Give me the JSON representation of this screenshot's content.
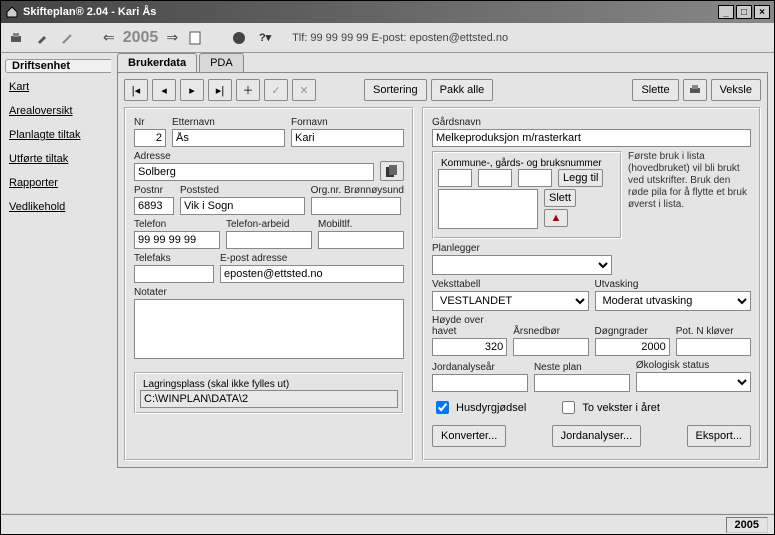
{
  "window": {
    "title": "Skifteplan® 2.04 - Kari Ås"
  },
  "toolbar": {
    "year": "2005",
    "contact": "Tlf: 99 99 99 99  E-post: eposten@ettsted.no"
  },
  "sidebar": {
    "tab": "Driftsenhet",
    "items": [
      "Kart",
      "Arealoversikt",
      "Planlagte tiltak",
      "Utførte tiltak",
      "Rapporter",
      "Vedlikehold"
    ]
  },
  "tabs": {
    "brukerdata": "Brukerdata",
    "pda": "PDA"
  },
  "buttons": {
    "sortering": "Sortering",
    "pakk_alle": "Pakk alle",
    "slette": "Slette",
    "veksle": "Veksle",
    "legg_til": "Legg til",
    "slett": "Slett",
    "konverter": "Konverter...",
    "jordanalyser": "Jordanalyser...",
    "eksport": "Eksport..."
  },
  "labels": {
    "nr": "Nr",
    "etternavn": "Etternavn",
    "fornavn": "Fornavn",
    "adresse": "Adresse",
    "postnr": "Postnr",
    "poststed": "Poststed",
    "orgnr": "Org.nr. Brønnøysund",
    "telefon": "Telefon",
    "telefon_arbeid": "Telefon-arbeid",
    "mobiltlf": "Mobiltlf.",
    "telefaks": "Telefaks",
    "epost": "E-post adresse",
    "notater": "Notater",
    "lagring": "Lagringsplass (skal ikke fylles ut)",
    "gardsnavn": "Gårdsnavn",
    "kommune": "Kommune-, gårds- og bruksnummer",
    "helptext": "Første bruk i lista (hovedbruket) vil bli brukt ved utskrifter. Bruk den røde pila for å flytte et bruk øverst i lista.",
    "planlegger": "Planlegger",
    "veksttabell": "Veksttabell",
    "utvasking": "Utvasking",
    "hoyde": "Høyde over havet",
    "arsnedbor": "Årsnedbør",
    "dogngrader": "Døgngrader",
    "pot_n": "Pot. N kløver",
    "jordanalysear": "Jordanalyseår",
    "neste_plan": "Neste plan",
    "okologisk": "Økologisk status",
    "husdyr": "Husdyrgjødsel",
    "to_vekster": "To vekster i året"
  },
  "values": {
    "nr": "2",
    "etternavn": "Ås",
    "fornavn": "Kari",
    "adresse": "Solberg",
    "postnr": "6893",
    "poststed": "Vik i Sogn",
    "orgnr": "",
    "telefon": "99 99 99 99",
    "telefon_arbeid": "",
    "mobiltlf": "",
    "telefaks": "",
    "epost": "eposten@ettsted.no",
    "notater": "",
    "lagring": "C:\\WINPLAN\\DATA\\2",
    "gardsnavn": "Melkeproduksjon m/rasterkart",
    "kommune1": "",
    "kommune2": "",
    "kommune3": "",
    "planlegger": "",
    "veksttabell": "VESTLANDET",
    "utvasking": "Moderat utvasking",
    "hoyde": "320",
    "arsnedbor": "",
    "dogngrader": "2000",
    "pot_n": "",
    "jordanalysear": "",
    "neste_plan": "",
    "okologisk": "",
    "husdyr_checked": true,
    "to_vekster_checked": false
  },
  "status": {
    "year": "2005"
  }
}
